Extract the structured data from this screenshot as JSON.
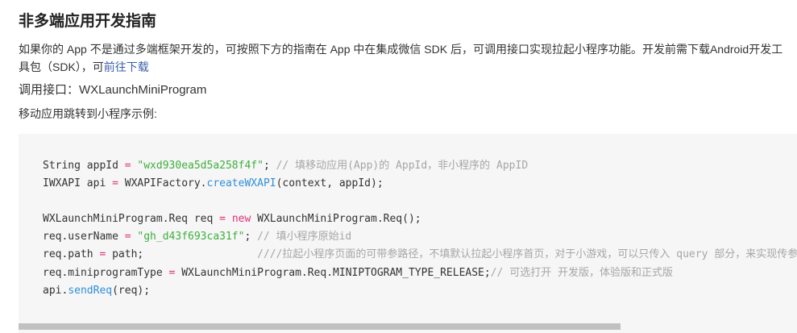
{
  "section": {
    "title": "非多端应用开发指南",
    "intro_text": "如果你的 App 不是通过多端框架开发的，可按照下方的指南在 App 中在集成微信 SDK 后，可调用接口实现拉起小程序功能。开发前需下载Android开发工具包（SDK），可",
    "download_link": "前往下载",
    "api_label": "调用接口：WXLaunchMiniProgram",
    "example_label": "移动应用跳转到小程序示例:"
  },
  "code": {
    "lines": [
      {
        "parts": [
          {
            "t": "String appId ",
            "k": ""
          },
          {
            "t": "=",
            "k": "o"
          },
          {
            "t": " ",
            "k": ""
          },
          {
            "t": "\"wxd930ea5d5a258f4f\"",
            "k": "s"
          },
          {
            "t": "; ",
            "k": ""
          },
          {
            "t": "// 填移动应用(App)的 AppId，非小程序的 AppID",
            "k": "c"
          }
        ]
      },
      {
        "parts": [
          {
            "t": "IWXAPI api ",
            "k": ""
          },
          {
            "t": "=",
            "k": "o"
          },
          {
            "t": " WXAPIFactory.",
            "k": ""
          },
          {
            "t": "createWXAPI",
            "k": "f"
          },
          {
            "t": "(context, appId);",
            "k": ""
          }
        ]
      },
      {
        "parts": []
      },
      {
        "parts": [
          {
            "t": "WXLaunchMiniProgram.Req req ",
            "k": ""
          },
          {
            "t": "=",
            "k": "o"
          },
          {
            "t": " ",
            "k": ""
          },
          {
            "t": "new",
            "k": "k"
          },
          {
            "t": " WXLaunchMiniProgram.Req();",
            "k": ""
          }
        ]
      },
      {
        "parts": [
          {
            "t": "req.userName ",
            "k": ""
          },
          {
            "t": "=",
            "k": "o"
          },
          {
            "t": " ",
            "k": ""
          },
          {
            "t": "\"gh_d43f693ca31f\"",
            "k": "s"
          },
          {
            "t": "; ",
            "k": ""
          },
          {
            "t": "// 填小程序原始id",
            "k": "c"
          }
        ]
      },
      {
        "parts": [
          {
            "t": "req.path ",
            "k": ""
          },
          {
            "t": "=",
            "k": "o"
          },
          {
            "t": " path;                  ",
            "k": ""
          },
          {
            "t": "////拉起小程序页面的可带参路径，不填默认拉起小程序首页，对于小游戏，可以只传入 query 部分，来实现传参效果",
            "k": "c"
          }
        ]
      },
      {
        "parts": [
          {
            "t": "req.miniprogramType ",
            "k": ""
          },
          {
            "t": "=",
            "k": "o"
          },
          {
            "t": " WXLaunchMiniProgram.Req.MINIPTOGRAM_TYPE_RELEASE;",
            "k": ""
          },
          {
            "t": "// 可选打开 开发版，体验版和正式版",
            "k": "c"
          }
        ]
      },
      {
        "parts": [
          {
            "t": "api.",
            "k": ""
          },
          {
            "t": "sendReq",
            "k": "f"
          },
          {
            "t": "(req);",
            "k": ""
          }
        ]
      }
    ]
  },
  "scrollbar": {
    "visible_fraction": 0.773
  },
  "colors": {
    "string": "#3eaf3e",
    "comment": "#a6a6a6",
    "keyword": "#e0307a",
    "function": "#2f8fd8",
    "link": "#3a5fa8",
    "code_background": "#f6f6f6"
  }
}
